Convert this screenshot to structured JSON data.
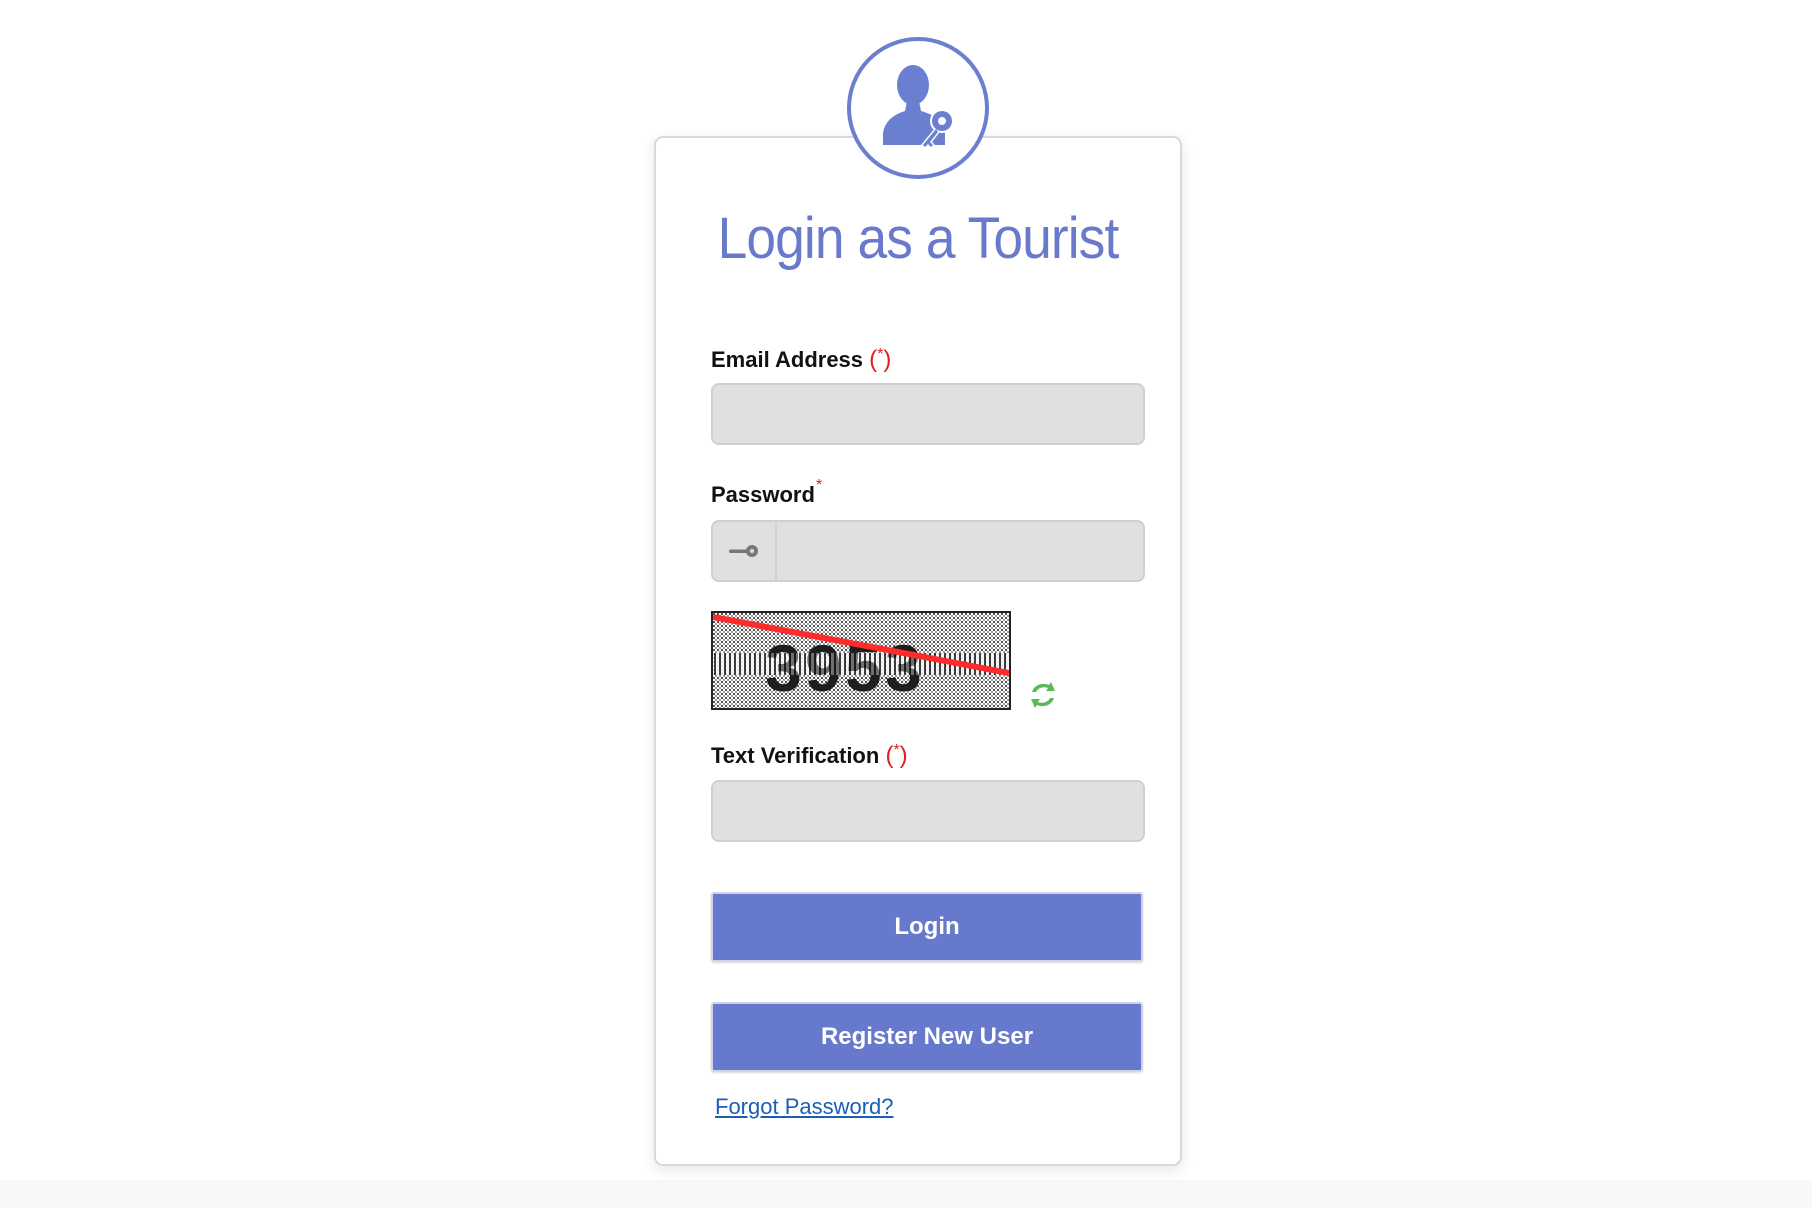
{
  "login_card": {
    "title": "Login as a Tourist",
    "email": {
      "label": "Email Address",
      "required_marker": "*",
      "value": "",
      "placeholder": ""
    },
    "password": {
      "label": "Password",
      "required_marker": "*",
      "value": "",
      "placeholder": ""
    },
    "text_verification": {
      "label": "Text Verification",
      "required_marker": "*",
      "value": "",
      "placeholder": ""
    },
    "login_button_label": "Login",
    "register_button_label": "Register New User",
    "forgot_password_label": "Forgot Password?"
  },
  "icons": {
    "avatar": "user-key-icon",
    "password_addon": "key-icon",
    "refresh": "refresh-icon"
  },
  "colors": {
    "accent": "#6779cc",
    "title": "#6a7acb",
    "required": "#e02020",
    "link": "#1a5fb4",
    "field_bg": "#e0e0e0",
    "refresh": "#4caf50"
  }
}
